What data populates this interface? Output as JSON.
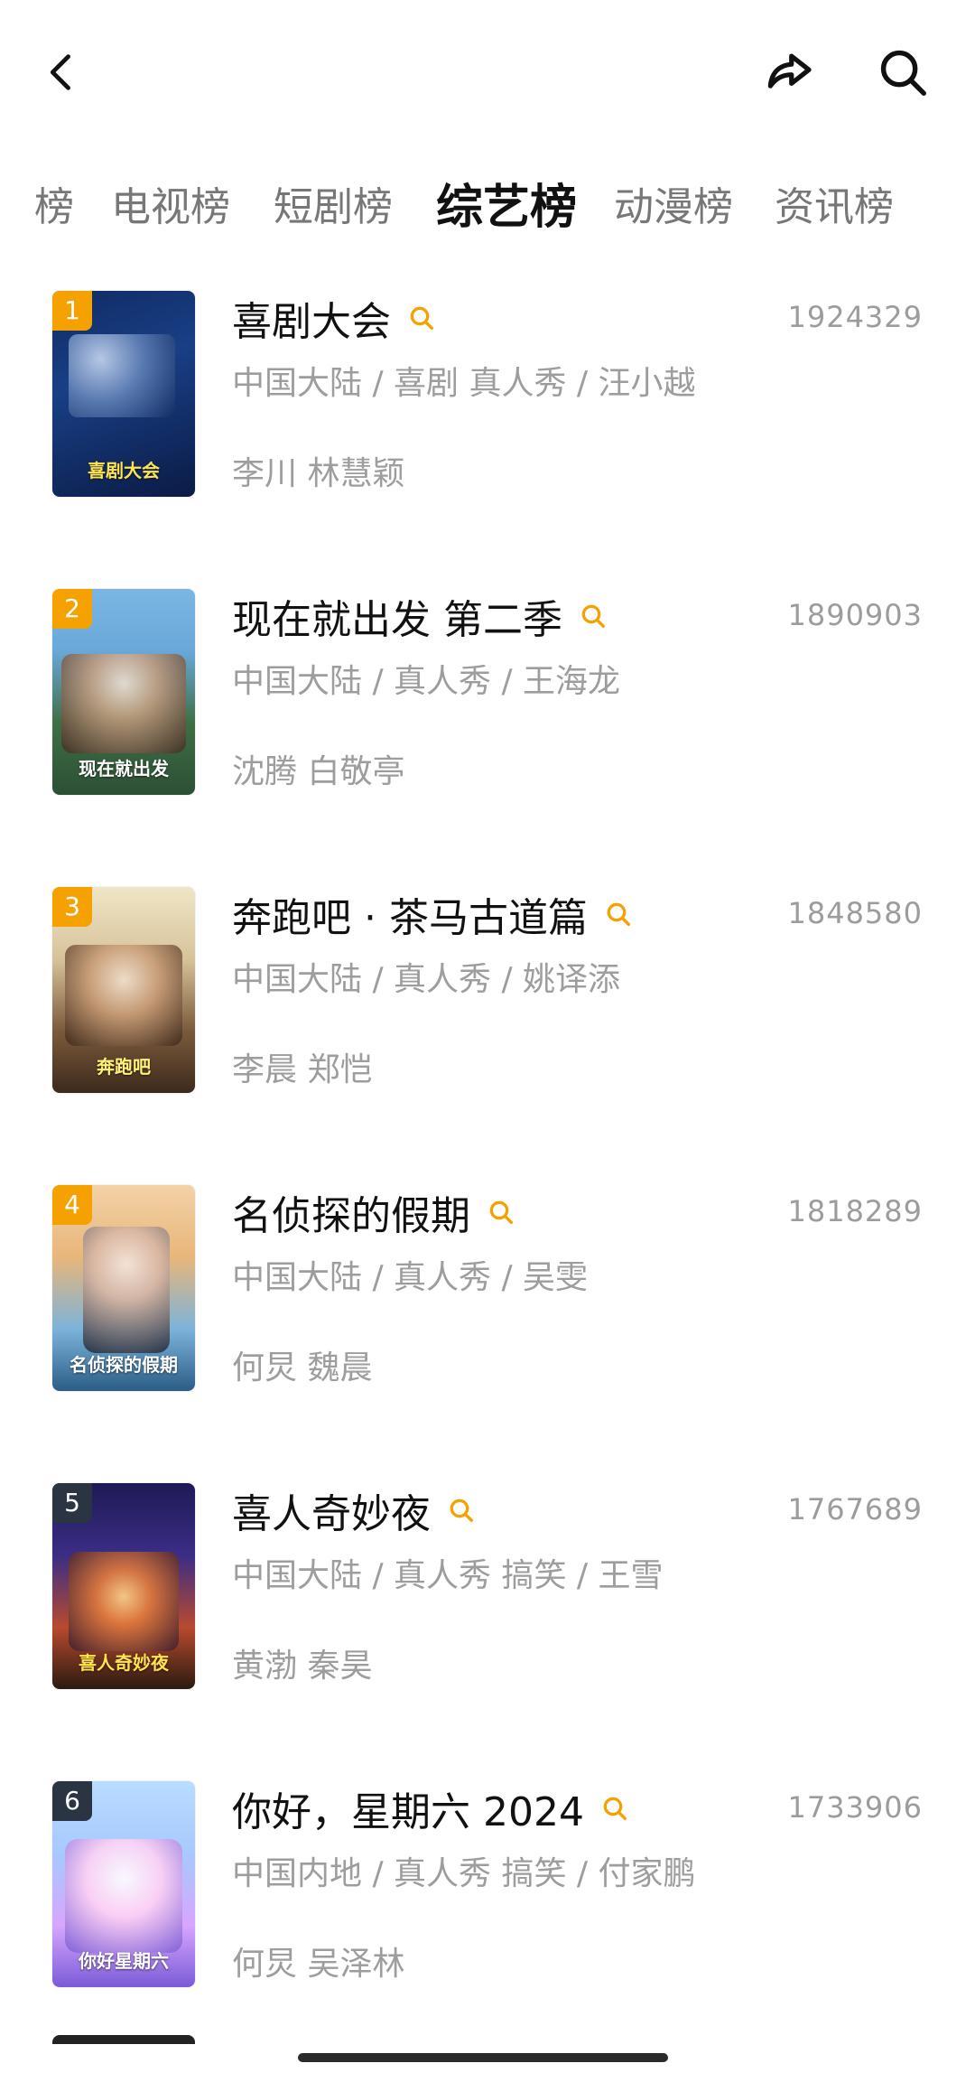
{
  "tabs": [
    {
      "label": "榜",
      "active": false
    },
    {
      "label": "电视榜",
      "active": false
    },
    {
      "label": "短剧榜",
      "active": false
    },
    {
      "label": "综艺榜",
      "active": true
    },
    {
      "label": "动漫榜",
      "active": false
    },
    {
      "label": "资讯榜",
      "active": false
    }
  ],
  "topbar": {
    "back_icon": "chevron-left",
    "share_icon": "share-arrow",
    "search_icon": "magnifier"
  },
  "colors": {
    "rank_top3": "#f5a100",
    "rank_other": "#2a3442",
    "search_accent": "#f5a100"
  },
  "items": [
    {
      "rank": "1",
      "title": "喜剧大会",
      "score": "1924329",
      "meta": "中国大陆 / 喜剧 真人秀 / 汪小越",
      "cast": "李川 林慧颖"
    },
    {
      "rank": "2",
      "title": "现在就出发 第二季",
      "score": "1890903",
      "meta": "中国大陆 / 真人秀 / 王海龙",
      "cast": "沈腾 白敬亭"
    },
    {
      "rank": "3",
      "title": "奔跑吧 · 茶马古道篇",
      "score": "1848580",
      "meta": "中国大陆 / 真人秀 / 姚译添",
      "cast": "李晨 郑恺"
    },
    {
      "rank": "4",
      "title": "名侦探的假期",
      "score": "1818289",
      "meta": "中国大陆 / 真人秀 / 吴雯",
      "cast": "何炅 魏晨"
    },
    {
      "rank": "5",
      "title": "喜人奇妙夜",
      "score": "1767689",
      "meta": "中国大陆 / 真人秀 搞笑 / 王雪",
      "cast": "黄渤 秦昊"
    },
    {
      "rank": "6",
      "title": "你好，星期六 2024",
      "score": "1733906",
      "meta": "中国内地 / 真人秀 搞笑 / 付家鹏",
      "cast": "何炅 吴泽林"
    }
  ]
}
